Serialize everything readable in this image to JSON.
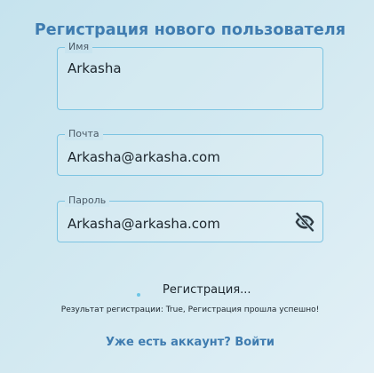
{
  "form": {
    "title": "Регистрация нового пользователя",
    "fields": {
      "name": {
        "label": "Имя",
        "value": "Arkasha"
      },
      "email": {
        "label": "Почта",
        "value": "Arkasha@arkasha.com"
      },
      "password": {
        "label": "Пароль",
        "value": "Arkasha@arkasha.com",
        "icon": "eye-off-icon"
      }
    },
    "status_text": "Регистрация...",
    "result_text": "Результат регистрации: True, Регистрация прошла успешно!",
    "login_link": "Уже есть аккаунт? Войти"
  },
  "colors": {
    "accent": "#3f7cb0",
    "field_border": "#7cc4e2",
    "spinner": "#6cc6e6"
  }
}
